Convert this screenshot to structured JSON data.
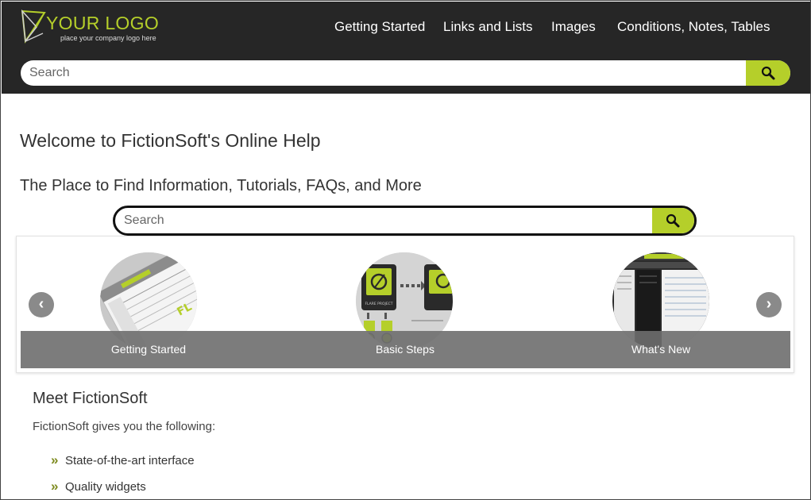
{
  "brand": {
    "logo_title": "YOUR LOGO",
    "logo_subtitle": "place your company logo here",
    "accent_color": "#b5cf2a",
    "header_bg": "#262626"
  },
  "nav": {
    "items": [
      "Getting Started",
      "Links and Lists",
      "Images",
      "Conditions, Notes, Tables"
    ]
  },
  "header_search": {
    "placeholder": "Search",
    "icon": "search-icon"
  },
  "main": {
    "title": "Welcome to FictionSoft's Online Help",
    "subtitle": "The Place to Find Information, Tutorials, FAQs, and More",
    "search": {
      "placeholder": "Search",
      "icon": "search-icon"
    }
  },
  "carousel": {
    "prev_icon": "chevron-left-icon",
    "next_icon": "chevron-right-icon",
    "slides": [
      {
        "caption": "Getting Started",
        "image_badge": "FL"
      },
      {
        "caption": "Basic Steps",
        "image_badge": "FLARE PROJECT"
      },
      {
        "caption": "What's New",
        "image_badge": ""
      }
    ]
  },
  "content": {
    "heading": "Meet FictionSoft",
    "intro": "FictionSoft gives you the following:",
    "bullet_glyph": "»",
    "features": [
      "State-of-the-art interface",
      "Quality widgets"
    ]
  }
}
